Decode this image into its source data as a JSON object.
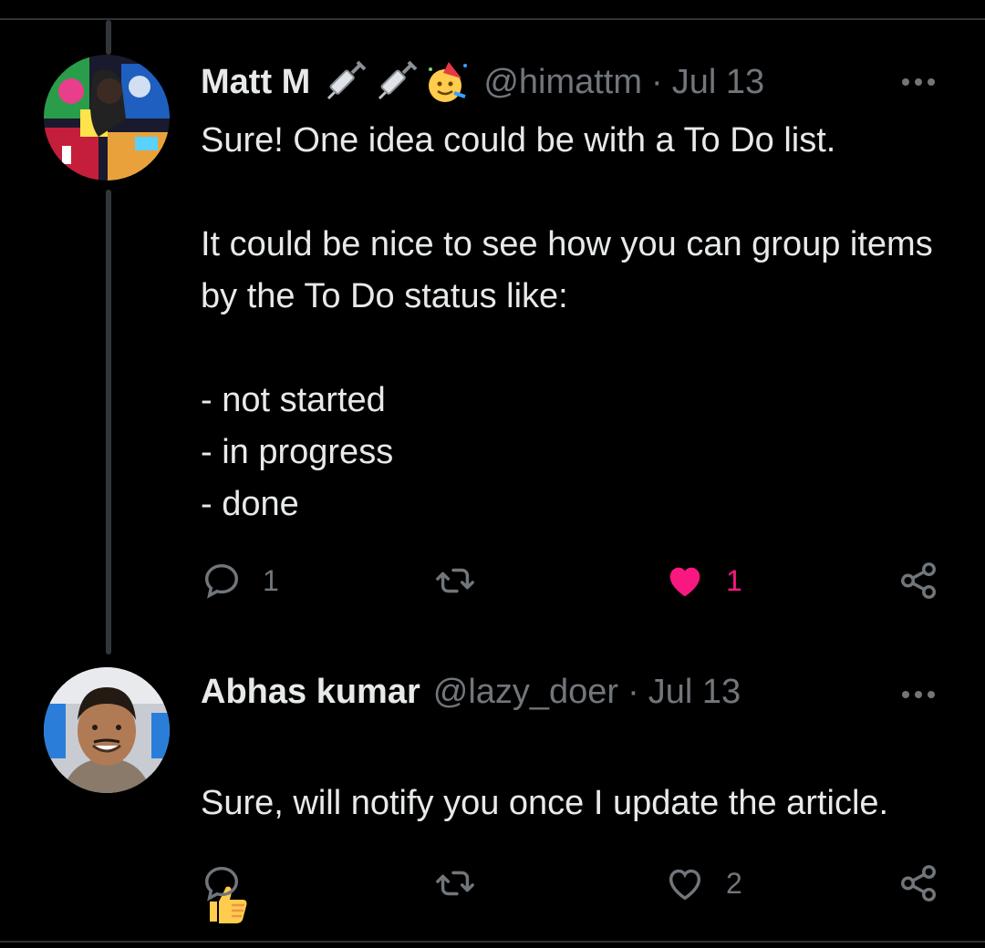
{
  "tweets": [
    {
      "name": "Matt M",
      "name_emojis": [
        "syringe-emoji",
        "syringe-emoji",
        "partying-face-emoji"
      ],
      "handle": "@himattm",
      "separator": "·",
      "date": "Jul 13",
      "text": "Sure! One idea could be with a To Do list.\n\nIt could be nice to see how you can group items by the To Do status like:\n\n- not started\n- in progress\n- done",
      "reply_count": "1",
      "retweet_count": "",
      "like_count": "1",
      "liked": true,
      "avatar_icon": "avatar-colorful-photo"
    },
    {
      "name": "Abhas kumar",
      "handle": "@lazy_doer",
      "separator": "·",
      "date": "Jul 13",
      "text": "Sure, will notify you once I update the article.",
      "text_emoji": "thumbs-up-emoji",
      "reply_count": "",
      "retweet_count": "",
      "like_count": "2",
      "liked": false,
      "avatar_icon": "avatar-person-photo"
    }
  ],
  "colors": {
    "background": "#000000",
    "text": "#e7e9ea",
    "secondary": "#71767b",
    "like": "#f91880",
    "divider": "#2f3336"
  }
}
